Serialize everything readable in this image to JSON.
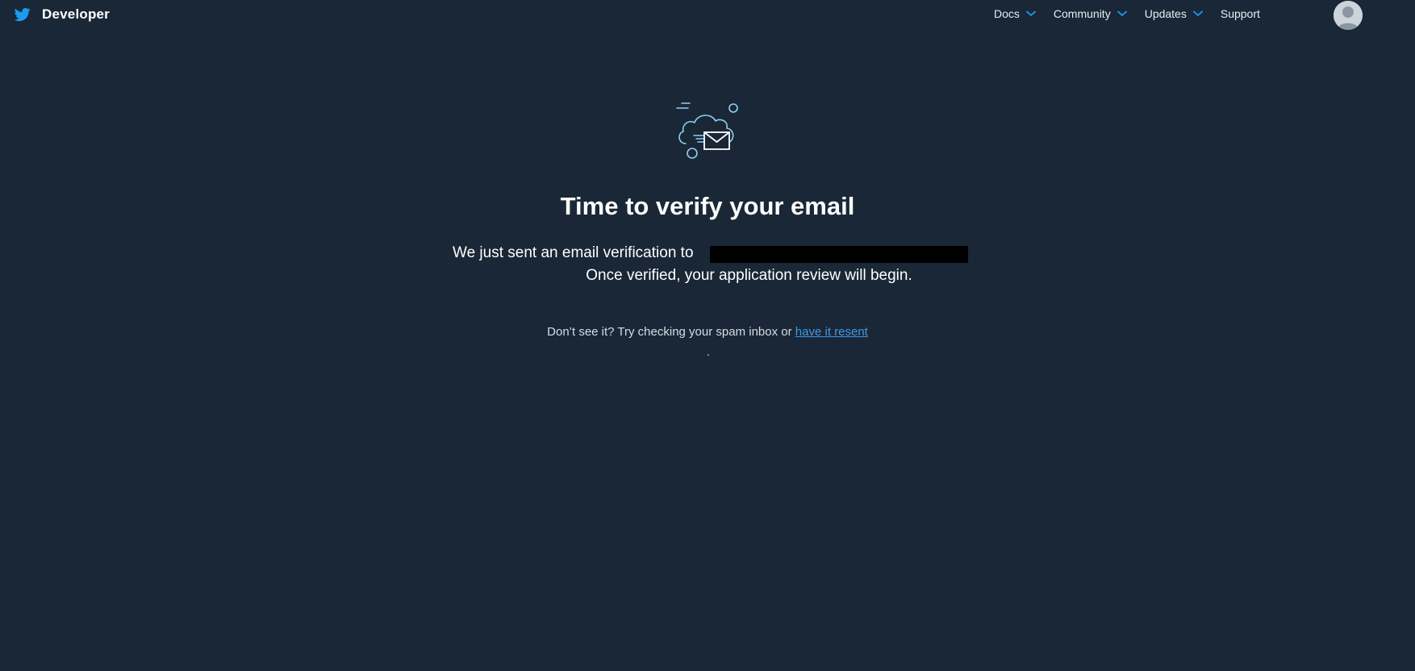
{
  "header": {
    "brand_label": "Developer",
    "nav": [
      {
        "label": "Docs",
        "has_dropdown": true
      },
      {
        "label": "Community",
        "has_dropdown": true
      },
      {
        "label": "Updates",
        "has_dropdown": true
      },
      {
        "label": "Support",
        "has_dropdown": false
      }
    ]
  },
  "main": {
    "icon": "cloud-envelope-icon",
    "title": "Time to verify your email",
    "sent_text": "We just sent an email verification to",
    "verified_text": "Once verified, your application review will begin.",
    "spam_text": "Don’t see it? Try checking your spam inbox or",
    "resend_link": "have it resent",
    "trailing_dot": "."
  },
  "colors": {
    "background": "#1a2736",
    "link": "#3d9be9",
    "accent": "#1d9bf0",
    "icon_stroke": "#8ed0f5"
  }
}
